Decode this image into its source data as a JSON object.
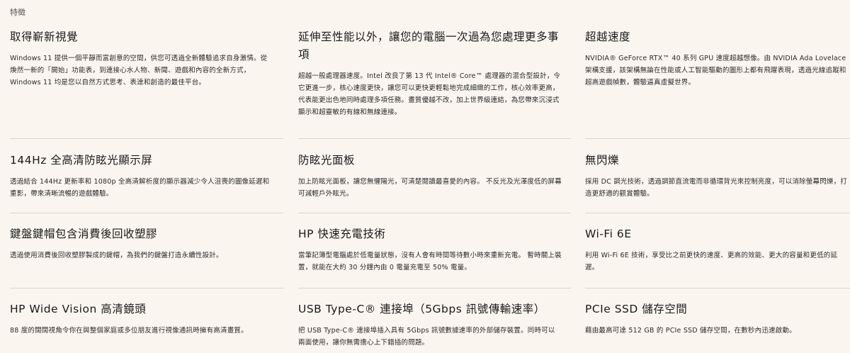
{
  "section_label": "特徵",
  "features": [
    {
      "title": "取得嶄新視覺",
      "desc": "Windows 11 提供一個平靜而富創意的空間，供您可透過全新體驗追求自身激情。從煥然一新的「開始」功能表，到連接心水人物、新聞、遊戲和內容的全新方式，Windows 11 均是您以自然方式思考、表達和創造的最佳平台。"
    },
    {
      "title": "延伸至性能以外，讓您的電腦一次過為您處理更多事項",
      "desc": "超越一般處理器速度。Intel 改良了第 13 代 Intel® Core™ 處理器的混合型設計，令它更進一步，核心速度更快，讓您可以更快更輕鬆地完成細緻的工作，核心效率更高，代表能更出色地同時處理多項任務。畫質優越不改，加上世界級連結，為您帶來沉浸式顯示和超靈敏的有線和無線連接。"
    },
    {
      "title": "超越速度",
      "desc": "NVIDIA® GeForce RTX™ 40 系列 GPU 速度超越想像。由 NVIDIA Ada Lovelace 架構支援，該架構無論在性能或人工智能驅動的圖形上都有飛躍表現，透過光線追蹤和超高遊戲幀數，體驗逼真虛擬世界。"
    },
    {
      "title": "144Hz 全高清防眩光顯示屏",
      "desc": "透過結合 144Hz 更新率和 1080p 全高清解析度的顯示器減少令人沮喪的圖像延遲和重影，帶來清晰流暢的遊戲體驗。"
    },
    {
      "title": "防眩光面板",
      "desc": "加上防眩光面板，讓您無懼陽光，可清楚閱讀最喜愛的內容。 不反光及光澤度低的屏幕可減輕戶外眩光。"
    },
    {
      "title": "無閃爍",
      "desc": "採用 DC 調光技術，透過調節直流電而非循環背光來控制亮度，可以消除螢幕閃爍，打造更舒適的觀賞體驗。"
    },
    {
      "title": "鍵盤鍵帽包含消費後回收塑膠",
      "desc": "透過使用消費後回收塑膠製成的鍵帽，為我們的鍵盤打造永續性設計。"
    },
    {
      "title": "HP 快速充電技術",
      "desc": "當筆記簿型電腦處於低電量狀態，沒有人會有時間等待數小時來重新充電。 暫時關上裝置，就能在大約 30 分鐘內由 0 電量充電至 50% 電量。"
    },
    {
      "title": "Wi-Fi 6E",
      "desc": "利用 Wi-Fi 6E 技術，享受比之前更快的速度、更高的效能、更大的容量和更低的延遲。"
    },
    {
      "title": "HP Wide Vision 高清鏡頭",
      "desc": "88 度的闊闊視角令你在與整個家庭或多位朋友進行視像通訊時擁有高清畫質。"
    },
    {
      "title": "USB Type-C® 連接埠（5Gbps 訊號傳輸速率）",
      "desc": "把 USB Type-C® 連接埠插入具有 5Gbps 訊號數據速率的外部儲存裝置。同時可以兩面使用，讓你無需擔心上下錯插的問題。"
    },
    {
      "title": "PCIe SSD 儲存空間",
      "desc": "藉由最高可達 512 GB 的 PCIe SSD 儲存空間，在數秒內迅速啟動。"
    }
  ]
}
